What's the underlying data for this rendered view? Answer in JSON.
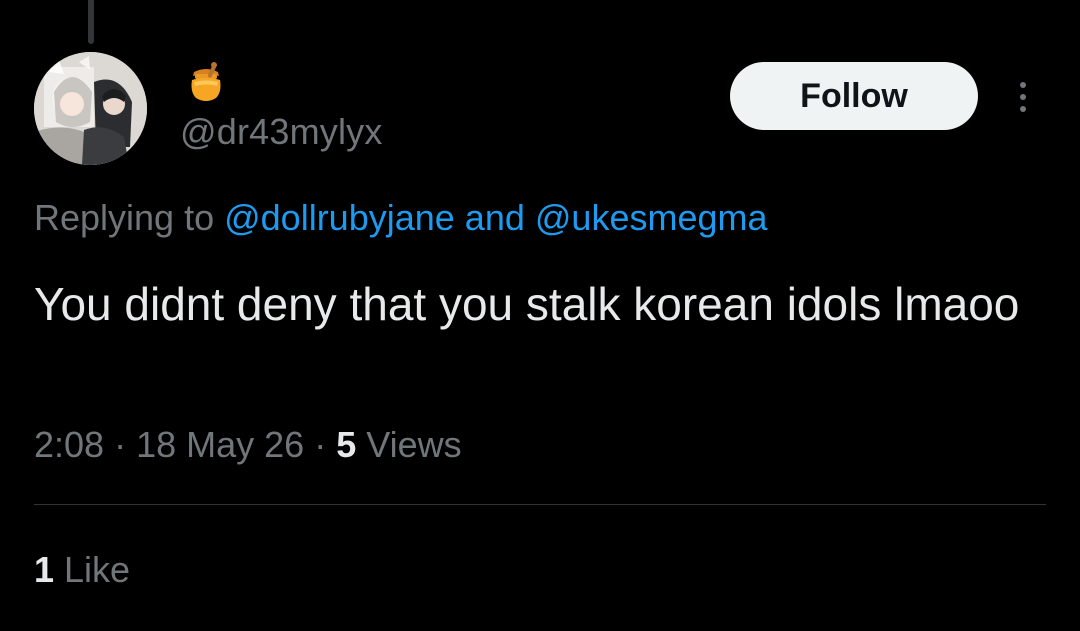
{
  "user": {
    "display_name_icon": "honey-pot-emoji-icon",
    "handle": "@dr43mylyx"
  },
  "actions": {
    "follow_label": "Follow",
    "more_icon": "more-vertical-icon"
  },
  "reply": {
    "prefix": "Replying to ",
    "mention_1": "@dollrubyjane",
    "conjunction": " and ",
    "mention_2": "@ukesmegma"
  },
  "tweet": {
    "text": "You didnt deny that you stalk korean idols lmaoo",
    "time": "2:08",
    "separator": " · ",
    "date": "18 May 26",
    "views_count": "5",
    "views_label": " Views"
  },
  "engagement": {
    "likes_count": "1",
    "likes_label": " Like"
  },
  "colors": {
    "background": "#000000",
    "text_primary": "#e7e9ea",
    "text_secondary": "#71767b",
    "link": "#1d9bf0",
    "follow_bg": "#eff3f4",
    "honey": "#f6a623"
  }
}
